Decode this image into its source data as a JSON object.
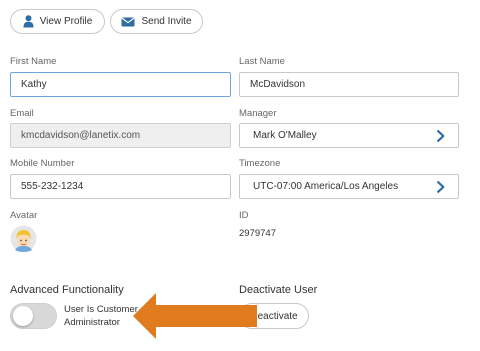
{
  "actions": {
    "view_profile": "View Profile",
    "send_invite": "Send Invite"
  },
  "form": {
    "first_name": {
      "label": "First Name",
      "value": "Kathy"
    },
    "last_name": {
      "label": "Last Name",
      "value": "McDavidson"
    },
    "email": {
      "label": "Email",
      "value": "kmcdavidson@lanetix.com"
    },
    "manager": {
      "label": "Manager",
      "value": "Mark O'Malley"
    },
    "mobile": {
      "label": "Mobile Number",
      "value": "555-232-1234"
    },
    "timezone": {
      "label": "Timezone",
      "value": "UTC-07:00 America/Los Angeles"
    },
    "avatar": {
      "label": "Avatar"
    },
    "id": {
      "label": "ID",
      "value": "2979747"
    }
  },
  "advanced": {
    "title": "Advanced Functionality",
    "toggle_label_1": "User Is Customer",
    "toggle_label_2": "Administrator",
    "toggle_on": false
  },
  "deactivate": {
    "title": "Deactivate User",
    "button": "Deactivate"
  },
  "colors": {
    "accent": "#2e6da4",
    "arrow": "#e07b1f"
  }
}
